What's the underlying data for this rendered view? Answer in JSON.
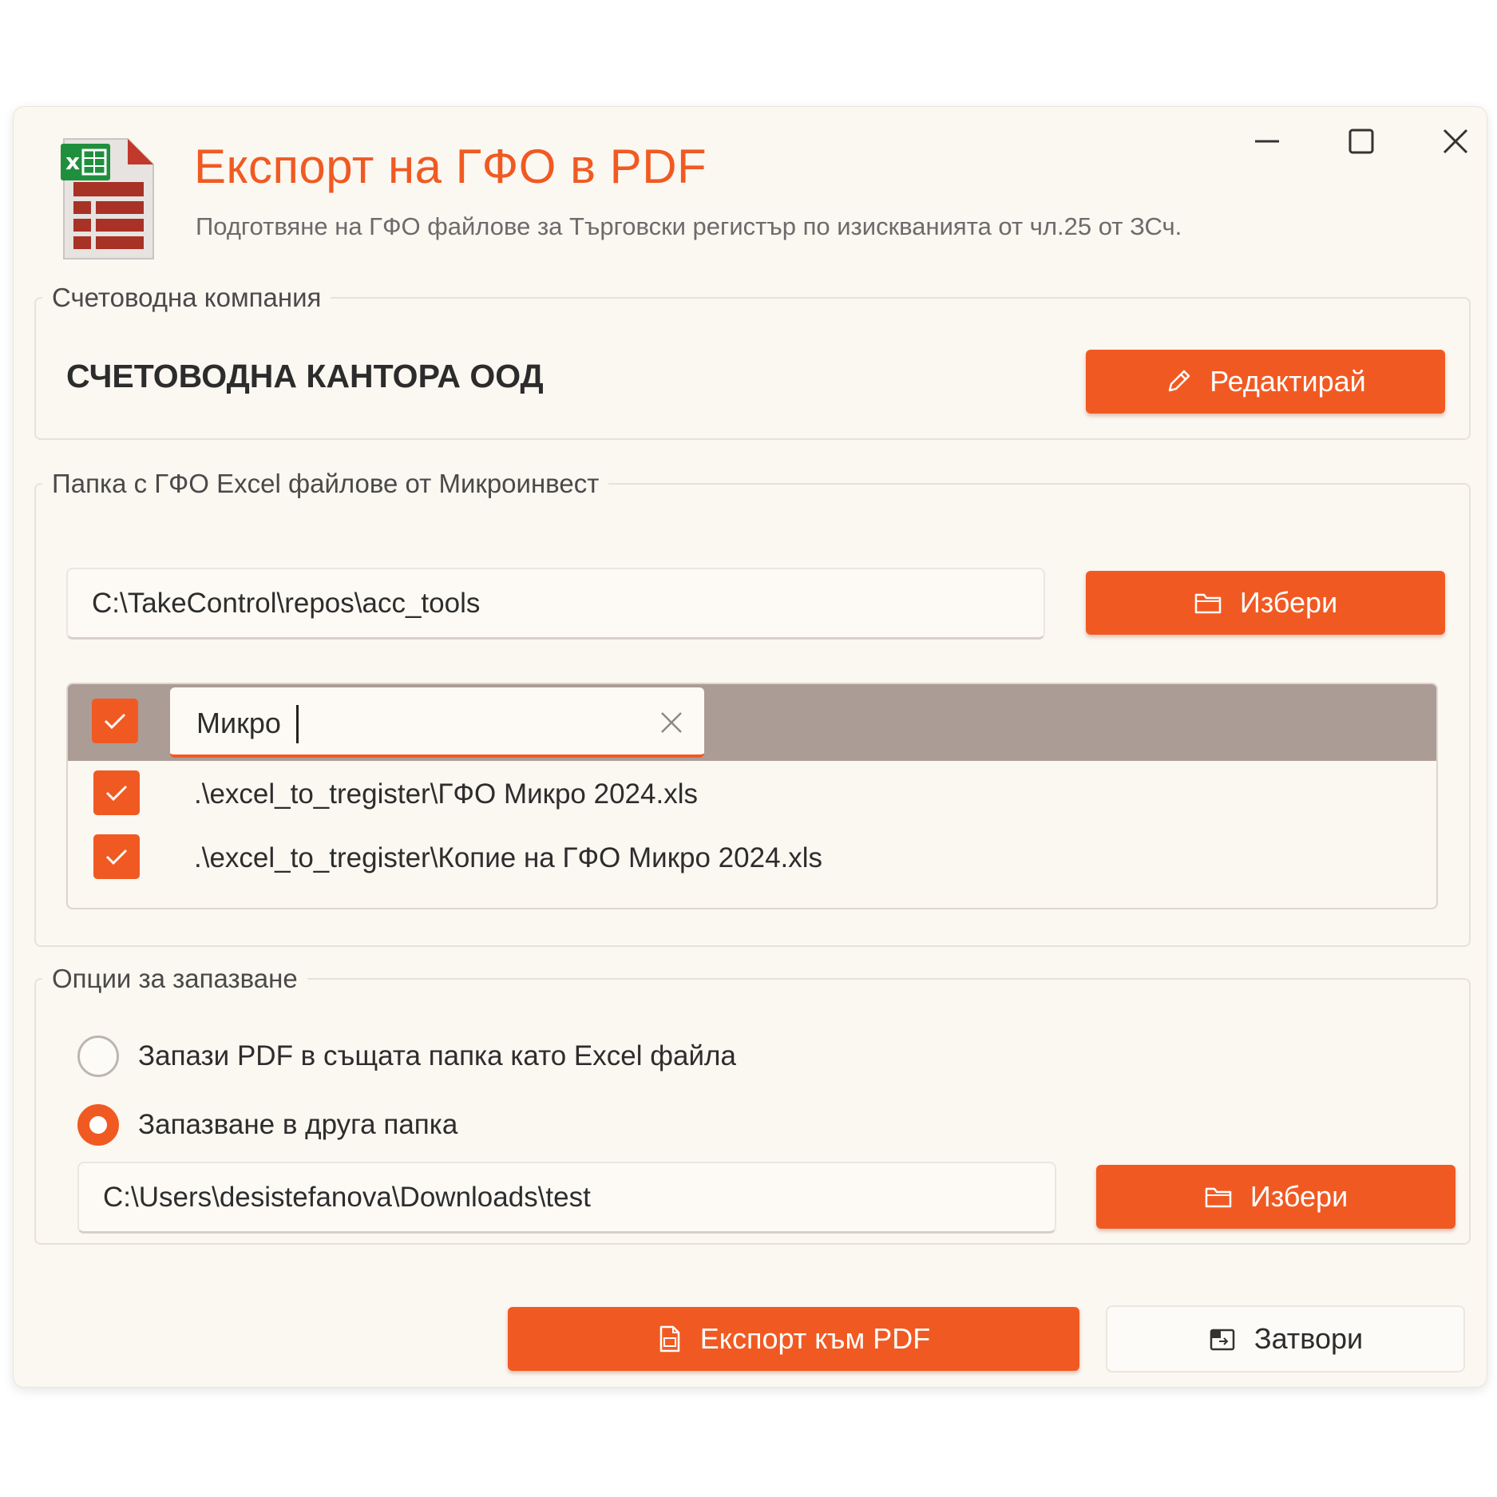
{
  "window": {
    "title": "Експорт на ГФО в PDF",
    "subtitle": "Подготвяне на ГФО файлове за Търговски регистър по изискванията от чл.25 от ЗСч."
  },
  "company_group": {
    "legend": "Счетоводна компания",
    "name": "СЧЕТОВОДНА КАНТОРА ООД",
    "edit_label": "Редактирай"
  },
  "folder_group": {
    "legend": "Папка с ГФО Excel файлове от Микроинвест",
    "path": "C:\\TakeControl\\repos\\acc_tools",
    "browse_label": "Избери",
    "filter_value": "Микро",
    "files": [
      {
        "name": ".\\excel_to_tregister\\ГФО Микро 2024.xls",
        "checked": true
      },
      {
        "name": ".\\excel_to_tregister\\Копие на ГФО Микро 2024.xls",
        "checked": true
      }
    ]
  },
  "save_group": {
    "legend": "Опции за запазване",
    "option_same": "Запази PDF в същата папка като Excel файла",
    "option_other": "Запазване в друга папка",
    "selected": "option_other",
    "path": "C:\\Users\\desistefanova\\Downloads\\test",
    "browse_label": "Избери"
  },
  "footer": {
    "export_label": "Експорт към PDF",
    "close_label": "Затвори"
  },
  "colors": {
    "accent": "#f05a22",
    "header_bar": "#ab9c95",
    "window_bg": "#fbf7f1"
  }
}
